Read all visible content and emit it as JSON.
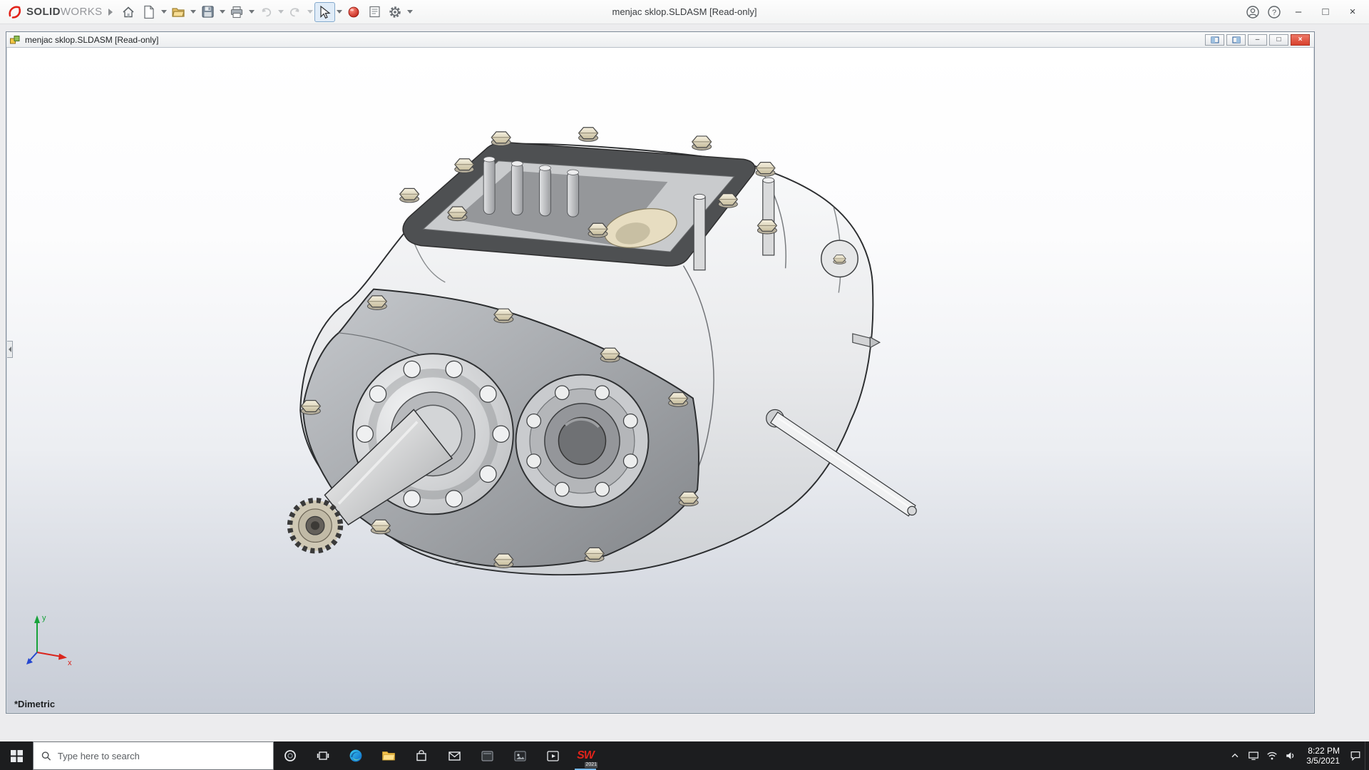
{
  "app": {
    "brand": {
      "solid": "SOLID",
      "works": "WORKS"
    },
    "title": "menjac sklop.SLDASM [Read-only]",
    "help_glyph": "?",
    "window": {
      "minimize": "–",
      "maximize": "□",
      "close": "×"
    },
    "toolbar_icons": [
      "home-icon",
      "new-document-icon",
      "open-folder-icon",
      "save-icon",
      "print-icon",
      "undo-icon",
      "redo-icon",
      "select-arrow-icon",
      "red-sphere-icon",
      "properties-icon",
      "settings-gear-icon"
    ]
  },
  "doc": {
    "title": "menjac sklop.SLDASM [Read-only]",
    "view_orientation": "*Dimetric",
    "window": {
      "minimize": "–",
      "restore": "□",
      "close": "×"
    },
    "triad": {
      "x": "x",
      "y": "y"
    }
  },
  "taskbar": {
    "search_placeholder": "Type here to search",
    "sw_mark": "SW",
    "solidworks_badge": "2021",
    "clock": {
      "time": "8:22 PM",
      "date": "3/5/2021"
    },
    "app_icons": [
      "start-icon",
      "cortana-icon",
      "task-view-icon",
      "edge-icon",
      "file-explorer-icon",
      "store-icon",
      "mail-icon",
      "screenshot-app-icon",
      "photos-app-icon",
      "movies-app-icon",
      "solidworks-app-icon"
    ],
    "tray_icons": [
      "chevron-up-icon",
      "display-icon",
      "wifi-icon",
      "volume-icon",
      "action-center-icon"
    ]
  },
  "colors": {
    "brand_red": "#e2231a",
    "taskbar_bg": "#1c1d1f",
    "close_red": "#d7402d",
    "triad_x": "#da251d",
    "triad_y": "#17a23a",
    "triad_z": "#2547d0"
  }
}
